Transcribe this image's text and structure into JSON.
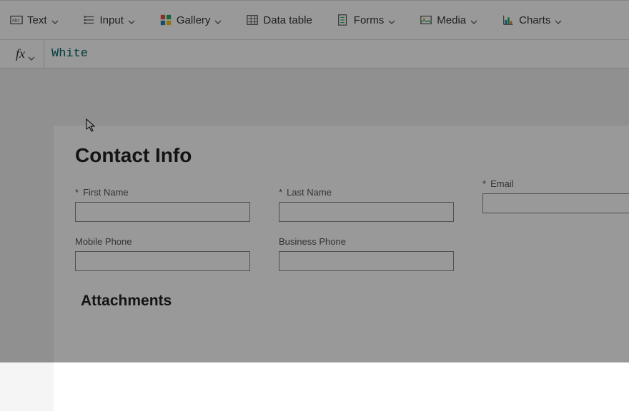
{
  "toolbar": {
    "text": "Text",
    "input": "Input",
    "gallery": "Gallery",
    "datatable": "Data table",
    "forms": "Forms",
    "media": "Media",
    "charts": "Charts"
  },
  "formula": {
    "fx": "fx",
    "value": "White"
  },
  "form": {
    "title": "Contact Info",
    "first_name": "First Name",
    "last_name": "Last Name",
    "email": "Email",
    "mobile": "Mobile Phone",
    "business": "Business Phone",
    "attachments": "Attachments"
  }
}
